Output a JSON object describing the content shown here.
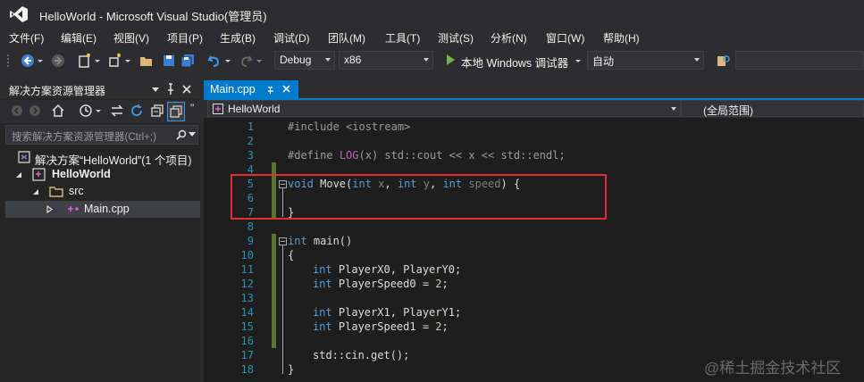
{
  "window": {
    "title": "HelloWorld - Microsoft Visual Studio(管理员)"
  },
  "menu": [
    "文件(F)",
    "编辑(E)",
    "视图(V)",
    "项目(P)",
    "生成(B)",
    "调试(D)",
    "团队(M)",
    "工具(T)",
    "测试(S)",
    "分析(N)",
    "窗口(W)",
    "帮助(H)"
  ],
  "toolbar": {
    "configuration": "Debug",
    "platform": "x86",
    "run_label": "本地 Windows 调试器",
    "mode": "自动"
  },
  "solution_explorer": {
    "title": "解决方案资源管理器",
    "search_placeholder": "搜索解决方案资源管理器(Ctrl+;)",
    "solution_label": "解决方案“HelloWorld”(1 个项目)",
    "project_label": "HelloWorld",
    "folder_label": "src",
    "file_label": "Main.cpp"
  },
  "editor": {
    "tab_label": "Main.cpp",
    "nav_project": "HelloWorld",
    "nav_scope": "(全局范围)",
    "line_numbers": [
      "1",
      "2",
      "3",
      "4",
      "5",
      "6",
      "7",
      "8",
      "9",
      "10",
      "11",
      "12",
      "13",
      "14",
      "15",
      "16",
      "17",
      "18"
    ],
    "code": {
      "l1_directive": "#include",
      "l1_header": " <iostream>",
      "l3_directive": "#define",
      "l3_space": " ",
      "l3_macro": "LOG",
      "l3_rest": "(x) std::cout << x << std::endl;",
      "l5_void": "void",
      "l5_name": " Move(",
      "kw_int": "int",
      "l5_x": " x",
      "comma": ", ",
      "l5_y": " y",
      "l5_speed": " speed",
      "l5_close": ") {",
      "close_brace": "}",
      "open_brace": "{",
      "l9_main": " main()",
      "l11_rest": " PlayerX0, PlayerY0;",
      "l12_rest": " PlayerSpeed0 = ",
      "l12_num": "2",
      "semicolon": ";",
      "l14_rest": " PlayerX1, PlayerY1;",
      "l15_rest": " PlayerSpeed1 = ",
      "l15_num": "2",
      "l17": "std::cin.get();"
    }
  },
  "watermark": "@稀土掘金技术社区",
  "colors": {
    "accent": "#007acc",
    "keyword": "#569cd6",
    "macro": "#bd63c5",
    "highlight": "#e03030"
  }
}
